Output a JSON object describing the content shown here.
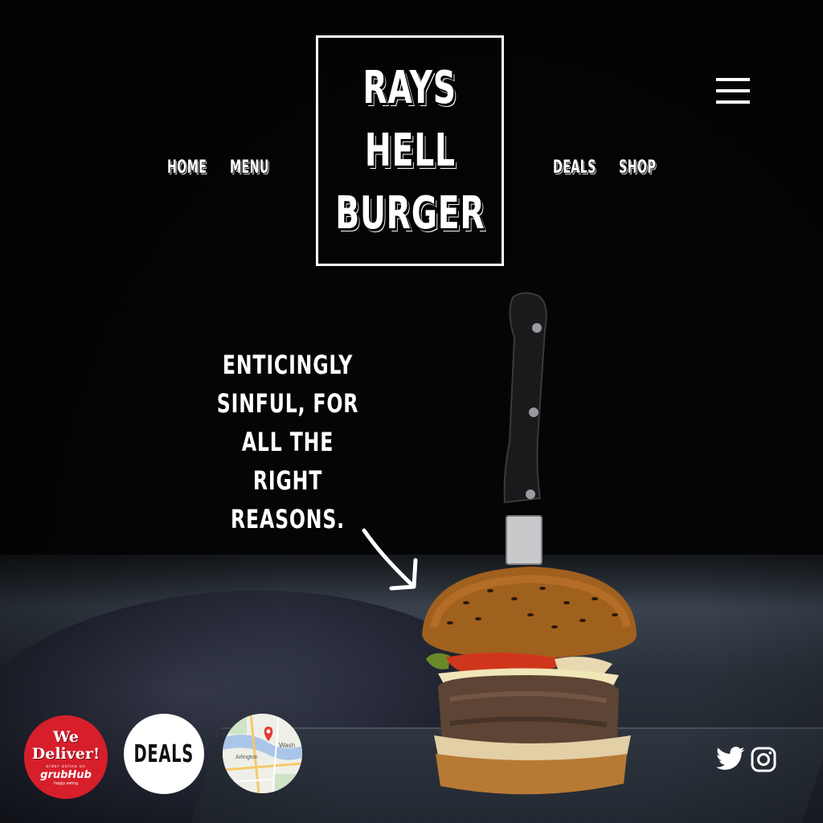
{
  "brand": {
    "lines": [
      "RAYS",
      "HELL",
      "BURGER"
    ]
  },
  "nav": {
    "left": [
      "HOME",
      "MENU"
    ],
    "right": [
      "DEALS",
      "SHOP"
    ]
  },
  "hero": {
    "tagline_lines": [
      "ENTICINGLY",
      "SINFUL, FOR",
      "ALL THE",
      "RIGHT REASONS."
    ]
  },
  "badges": {
    "grubhub": {
      "title_line1": "We",
      "title_line2": "Deliver!",
      "small": "order online on",
      "brand": "grubHub",
      "tagline": "happy eating"
    },
    "deals": {
      "label": "DEALS"
    },
    "map": {
      "place1": "Arlington",
      "place2": "Wash"
    }
  },
  "social": {
    "icons": [
      "twitter-icon",
      "instagram-icon"
    ]
  },
  "colors": {
    "background": "#050505",
    "text": "#ffffff",
    "grubhub_red": "#d71f2c",
    "deals_bg": "#ffffff"
  }
}
